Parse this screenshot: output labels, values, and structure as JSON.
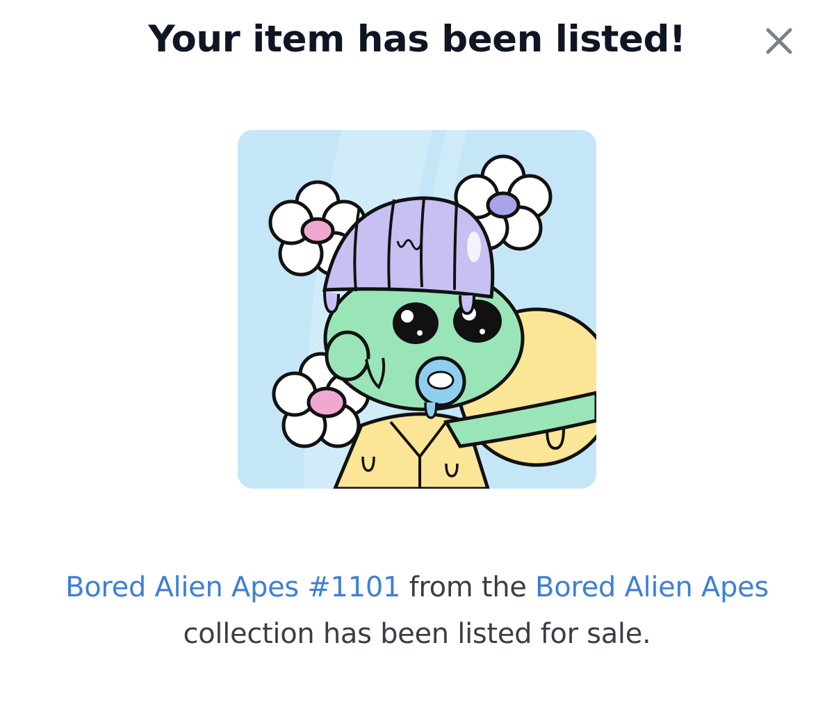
{
  "dialog": {
    "title": "Your item has been listed!",
    "close_icon": "close-icon"
  },
  "artwork": {
    "icon": "nft-artwork-image",
    "background_color": "#c5e6f7"
  },
  "message": {
    "item_link": "Bored Alien Apes #1101",
    "text_1": " from the ",
    "collection_link": "Bored Alien Apes",
    "text_2": "collection has been listed for sale."
  },
  "colors": {
    "title": "#0f1623",
    "link": "#3e7fd6",
    "body_text": "#3a3d45"
  }
}
